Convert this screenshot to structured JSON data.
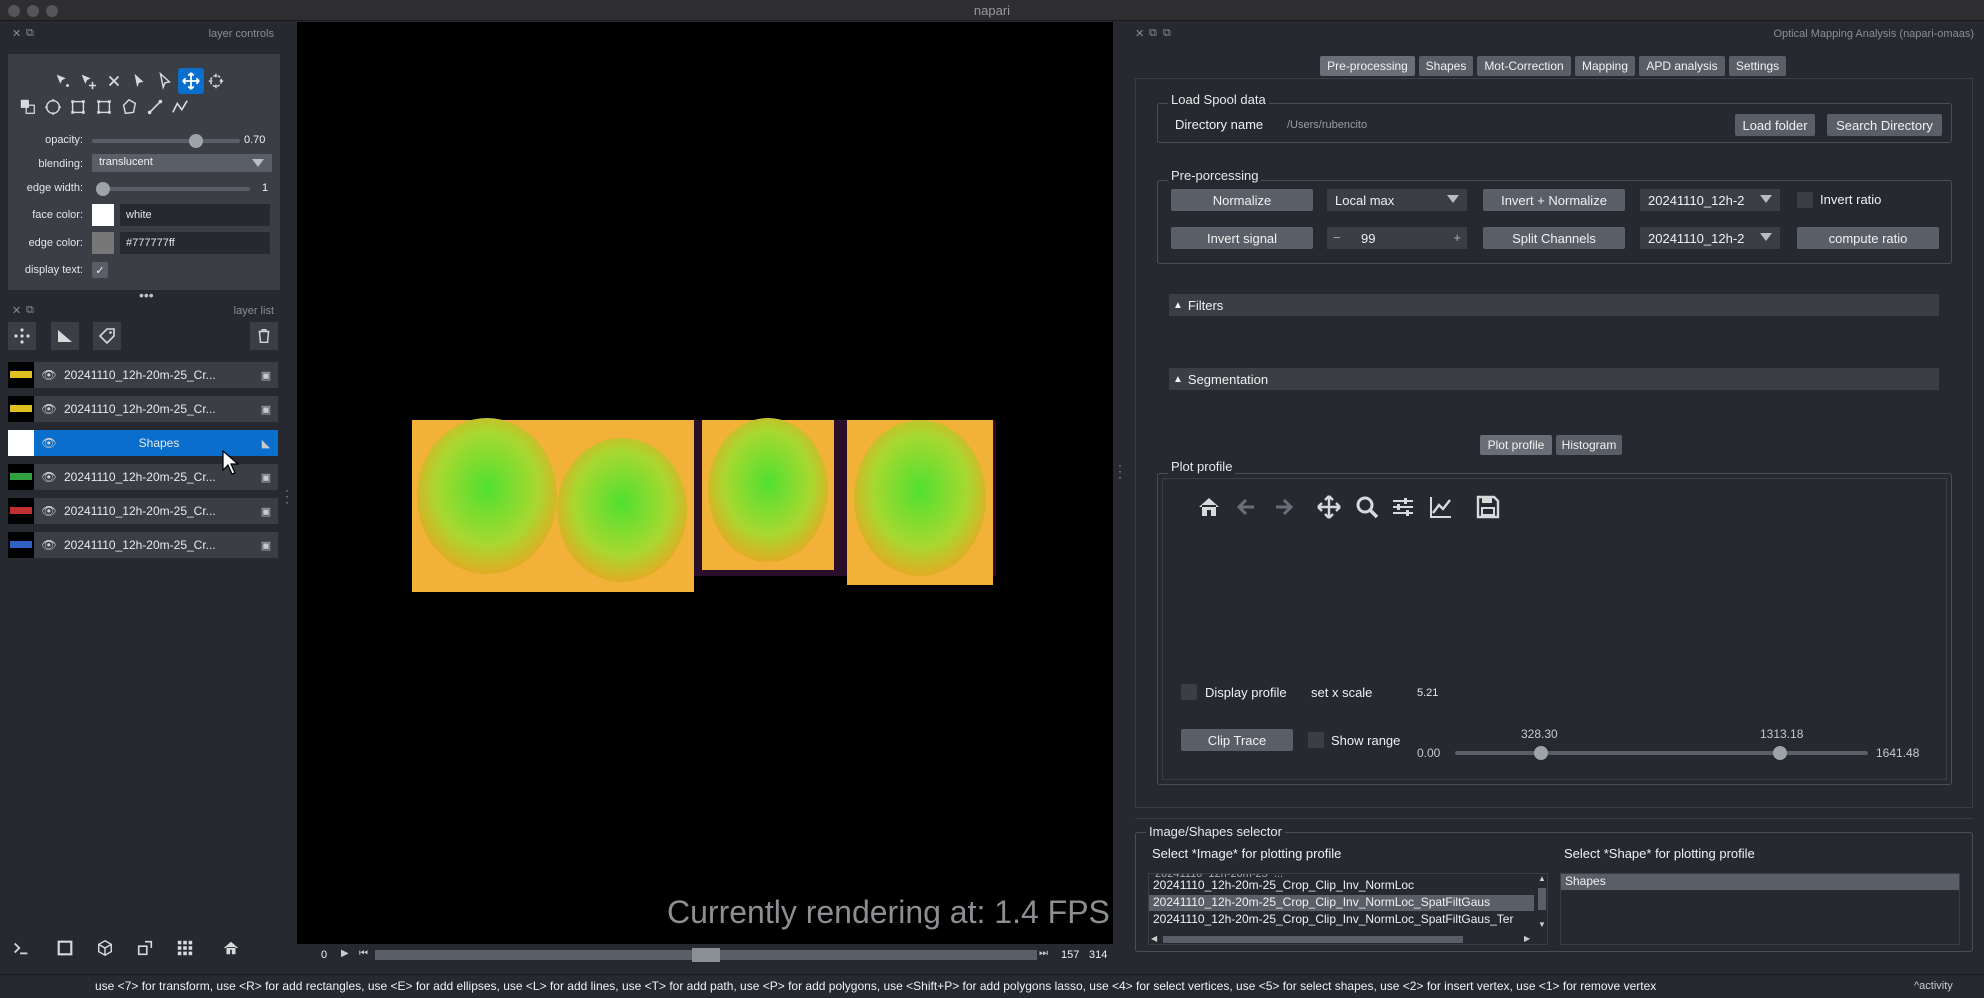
{
  "window": {
    "title": "napari"
  },
  "layer_controls": {
    "header": "layer controls",
    "opacity_label": "opacity:",
    "opacity_value": "0.70",
    "opacity_fraction": 0.7,
    "blending_label": "blending:",
    "blending_value": "translucent",
    "edge_width_label": "edge width:",
    "edge_width_value": "1",
    "face_color_label": "face color:",
    "face_color_value": "white",
    "face_color_swatch": "#ffffff",
    "edge_color_label": "edge color:",
    "edge_color_value": "#777777ff",
    "edge_color_swatch": "#777777",
    "display_text_label": "display text:",
    "display_text_checked": true,
    "tool_icons": [
      "select-points-icon",
      "add-points-icon",
      "delete-icon",
      "select-shapes-icon",
      "direct-select-icon",
      "pan-zoom-icon",
      "transform-icon",
      "move-front-icon",
      "move-back-icon",
      "ellipse-icon",
      "rectangle-icon",
      "rectangle-icon",
      "polygon-icon",
      "line-icon",
      "path-icon"
    ]
  },
  "layer_list": {
    "header": "layer list",
    "layers": [
      {
        "name": "20241110_12h-20m-25_Cr...",
        "selected": false,
        "thumb": "#e0c020"
      },
      {
        "name": "20241110_12h-20m-25_Cr...",
        "selected": false,
        "thumb": "#e0c020"
      },
      {
        "name": "Shapes",
        "selected": true,
        "thumb": "#ffffff"
      },
      {
        "name": "20241110_12h-20m-25_Cr...",
        "selected": false,
        "thumb": "#30a040"
      },
      {
        "name": "20241110_12h-20m-25_Cr...",
        "selected": false,
        "thumb": "#c03030"
      },
      {
        "name": "20241110_12h-20m-25_Cr...",
        "selected": false,
        "thumb": "#3060c0"
      }
    ]
  },
  "canvas": {
    "fps_text": "Currently rendering at: 1.4 FPS",
    "slider_left": "0",
    "slider_current": "157",
    "slider_max": "314",
    "slider_fraction": 0.5
  },
  "status_bar": {
    "text": "use <7> for transform, use <R> for add rectangles, use <E> for add ellipses, use <L> for add lines, use <T> for add path, use <P> for add polygons, use <Shift+P> for add polygons lasso, use <4> for select vertices, use <5> for select shapes, use <2> for insert vertex, use <1> for remove vertex",
    "activity": "activity"
  },
  "plugin": {
    "header": "Optical Mapping Analysis (napari-omaas)",
    "tabs": [
      "Pre-processing",
      "Shapes",
      "Mot-Correction",
      "Mapping",
      "APD analysis",
      "Settings"
    ],
    "active_tab": "Pre-processing",
    "load_spool": {
      "title": "Load Spool data",
      "dir_label": "Directory name",
      "dir_value": "/Users/rubencito",
      "load_button": "Load folder",
      "search_button": "Search Directory"
    },
    "preprocessing": {
      "title": "Pre-porcessing",
      "normalize": "Normalize",
      "local_max": "Local max",
      "invert_normalize": "Invert + Normalize",
      "combo1": "20241110_12h-2",
      "invert_ratio": "Invert ratio",
      "invert_signal": "Invert signal",
      "spin_value": "99",
      "split_channels": "Split Channels",
      "combo2": "20241110_12h-2",
      "compute_ratio": "compute ratio"
    },
    "filters": "Filters",
    "segmentation": "Segmentation",
    "plot_tabs": [
      "Plot profile",
      "Histogram"
    ],
    "plot_profile": {
      "title": "Plot profile",
      "display_profile": "Display profile",
      "set_x_scale": "set x scale",
      "x_scale_value": "5.21",
      "clip_trace": "Clip Trace",
      "show_range": "Show range",
      "range_min": "0.00",
      "range_max": "1641.48",
      "handle_low": "328.30",
      "handle_high": "1313.18"
    },
    "selector": {
      "title": "Image/Shapes selector",
      "image_label": "Select *Image* for plotting profile",
      "shape_label": "Select *Shape* for plotting profile",
      "images": [
        "20241110_12h-20m-25_Crop_Clip_Inv_NormLoc",
        "20241110_12h-20m-25_Crop_Clip_Inv_NormLoc_SpatFiltGaus",
        "20241110_12h-20m-25_Crop_Clip_Inv_NormLoc_SpatFiltGaus_Ter"
      ],
      "selected_image_index": 1,
      "shapes": [
        "Shapes"
      ]
    }
  },
  "colors": {
    "accent": "#0a6ecd",
    "background": "#262930",
    "panel": "#3b3e45"
  }
}
